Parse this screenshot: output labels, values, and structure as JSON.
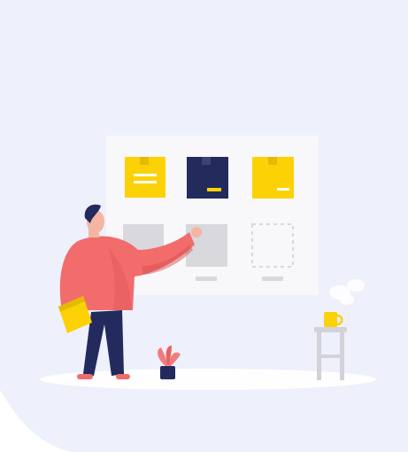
{
  "scene": {
    "subject": "person-organizing-boxes-illustration",
    "palette": {
      "background": "#eef0fb",
      "board": "#f8f8fb",
      "box_yellow": "#fcd206",
      "box_navy": "#232a5c",
      "placeholder_gray": "#d8d8dd",
      "shirt": "#f26c6c",
      "trousers": "#222a5e",
      "hair": "#232a5c",
      "skin": "#f5b5a2",
      "folder": "#fcd206",
      "plant_leaf": "#f27c7c",
      "pot": "#232a5c",
      "stool": "#d2d2d8",
      "mug": "#fcd206",
      "floor_ellipse": "#ffffff"
    },
    "icons": [
      "box-icon",
      "placeholder-icon",
      "plant-icon",
      "stool-icon",
      "mug-icon",
      "steam-icon"
    ]
  }
}
